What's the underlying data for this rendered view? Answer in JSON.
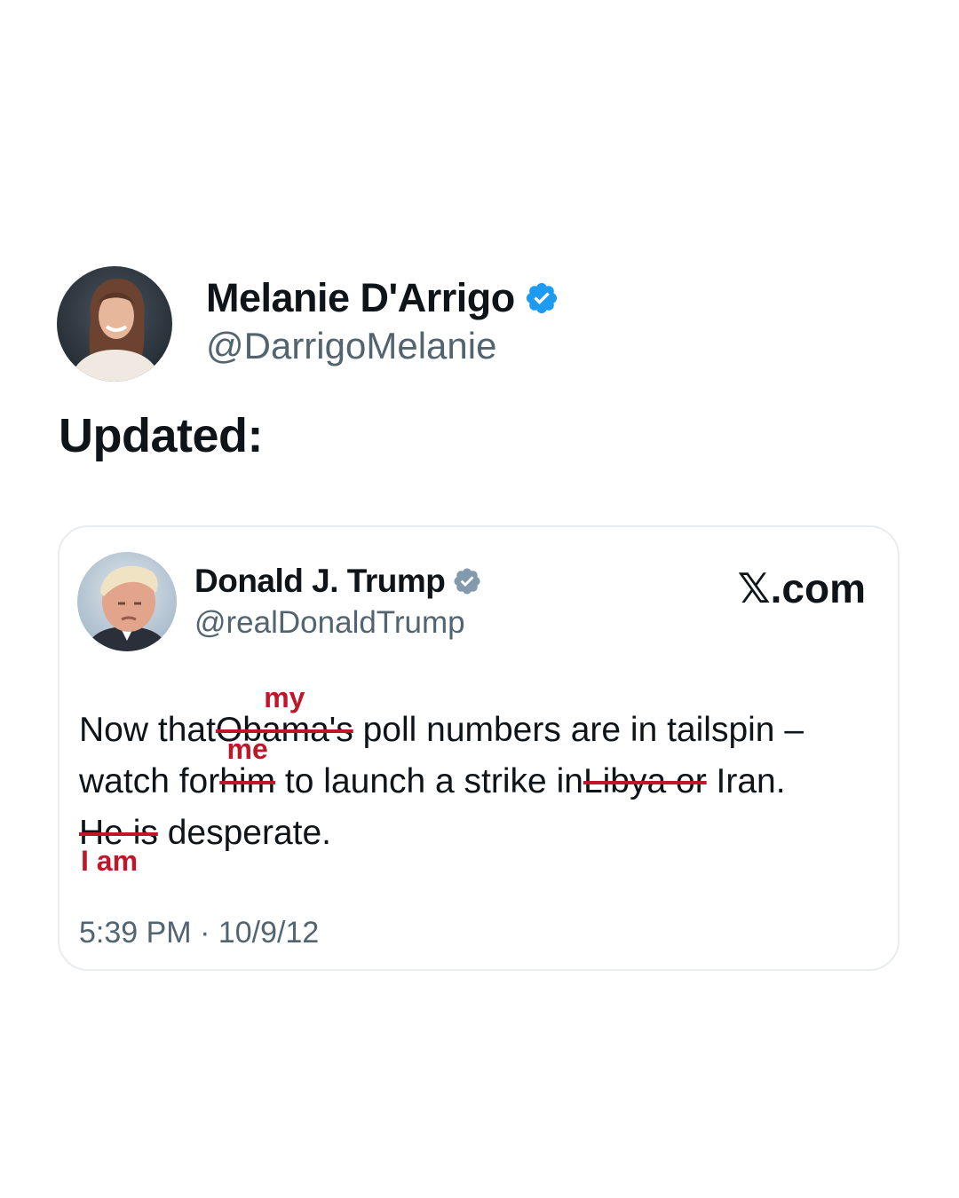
{
  "post": {
    "author": {
      "name": "Melanie D'Arrigo",
      "handle": "@DarrigoMelanie",
      "verified": true,
      "avatar_icon": "profile-photo"
    },
    "text": "Updated:"
  },
  "quoted": {
    "author": {
      "name": "Donald J. Trump",
      "handle": "@realDonaldTrump",
      "verified": true,
      "avatar_icon": "profile-photo"
    },
    "brand": "𝕏.com",
    "body": {
      "line1_pre": "Now that",
      "line1_struck": "Obama's",
      "line1_insert": "my",
      "line1_post": " poll numbers are in tailspin –",
      "line2_pre": "watch for",
      "line2_struck": "him",
      "line2_insert": "me",
      "line2_mid": " to launch a strike in",
      "line2_struck2": "Libya or",
      "line2_post": " Iran.",
      "line3_struck": "He is",
      "line3_insert": "I am",
      "line3_post": " desperate."
    },
    "timestamp": "5:39 PM · 10/9/12"
  },
  "colors": {
    "text": "#0f1419",
    "secondary": "#536471",
    "verified_blue": "#1d9bf0",
    "verified_gray": "#829aab",
    "edit_red": "#c0162a",
    "card_border": "#e9ecef"
  }
}
